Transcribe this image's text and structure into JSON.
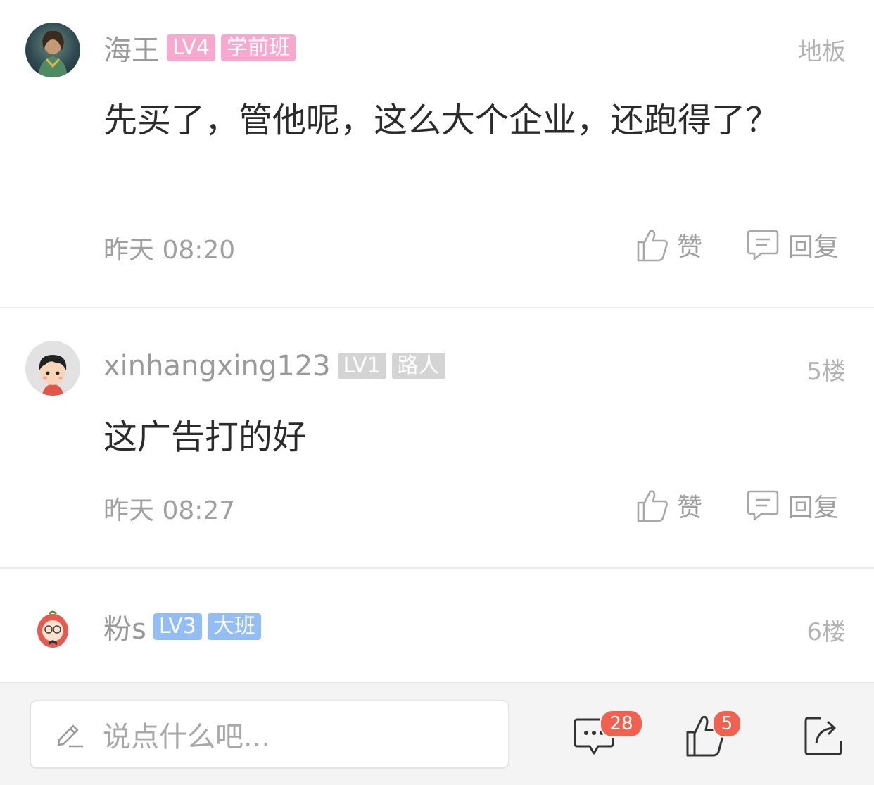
{
  "comments": [
    {
      "username": "海王",
      "level": "LV4",
      "rank": "学前班",
      "floor": "地板",
      "content": "先买了，管他呢，这么大个企业，还跑得了？",
      "time": "昨天 08:20",
      "like_label": "赞",
      "reply_label": "回复",
      "badge_color": "#f7a8cf"
    },
    {
      "username": "xinhangxing123",
      "level": "LV1",
      "rank": "路人",
      "floor": "5楼",
      "content": "这广告打的好",
      "time": "昨天 08:27",
      "like_label": "赞",
      "reply_label": "回复",
      "badge_color": "#d4d4d4"
    },
    {
      "username": "粉s",
      "level": "LV3",
      "rank": "大班",
      "floor": "6楼",
      "badge_color": "#93bef5"
    }
  ],
  "bottom_bar": {
    "input_placeholder": "说点什么吧...",
    "comment_count": "28",
    "like_count": "5",
    "badge_color": "#f0614f"
  }
}
